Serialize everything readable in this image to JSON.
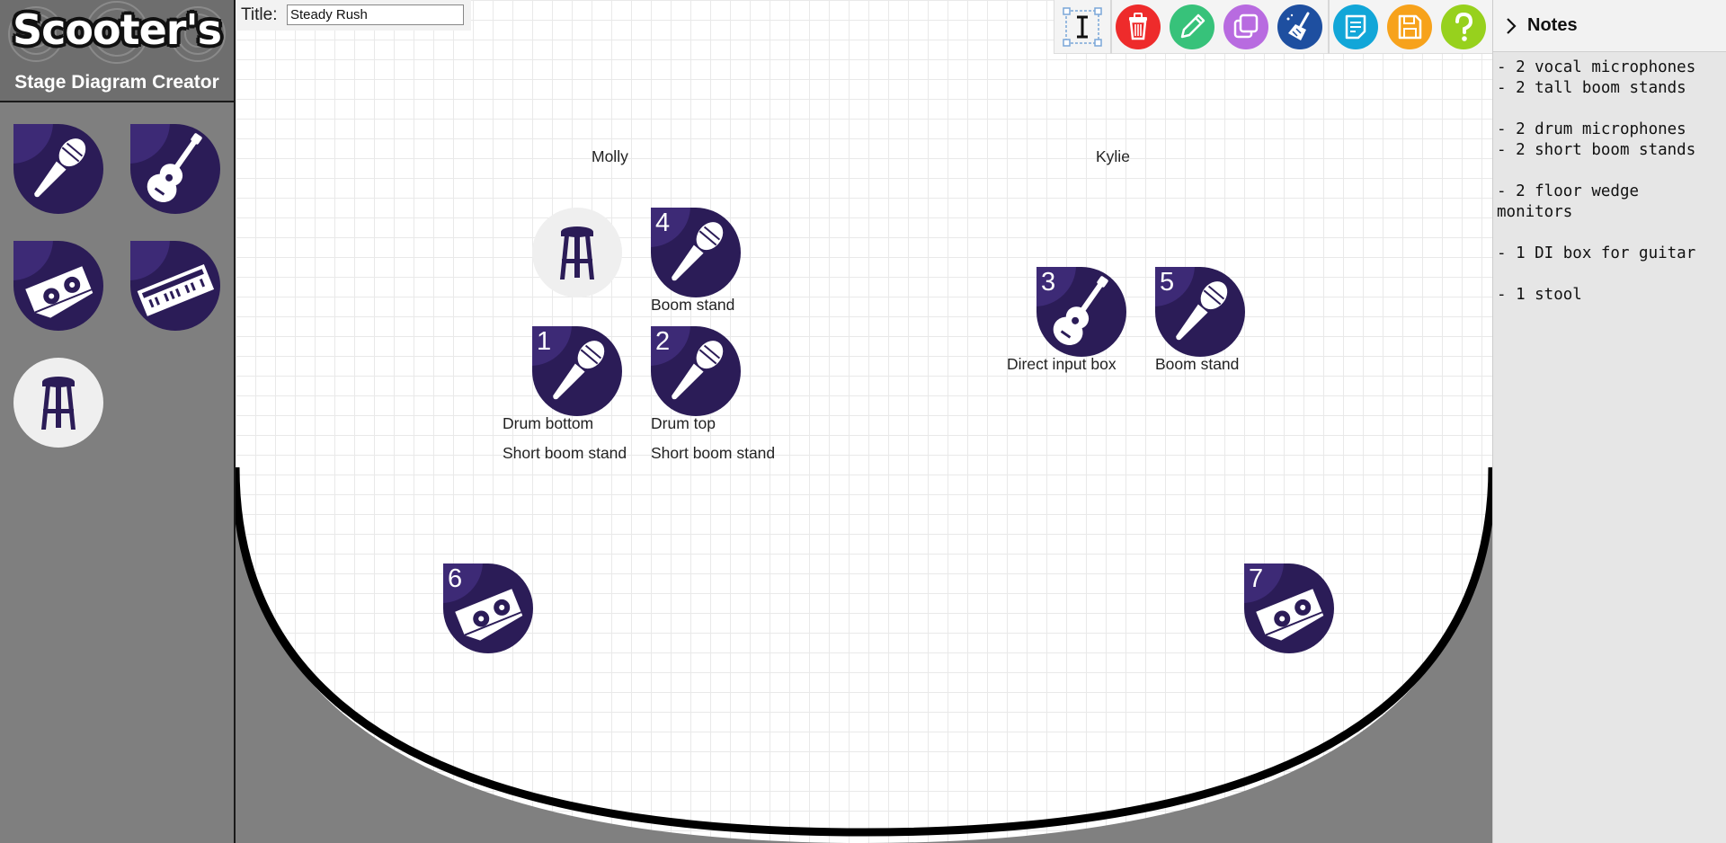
{
  "app": {
    "logo_text": "Scooter's",
    "title": "Stage Diagram Creator"
  },
  "palette": [
    {
      "name": "microphone",
      "icon": "microphone-icon"
    },
    {
      "name": "guitar",
      "icon": "guitar-icon"
    },
    {
      "name": "monitor-wedge",
      "icon": "monitor-wedge-icon"
    },
    {
      "name": "keyboard",
      "icon": "keyboard-icon"
    },
    {
      "name": "stool",
      "icon": "stool-icon"
    }
  ],
  "diagram": {
    "title_label": "Title:",
    "title_value": "Steady Rush",
    "performers": [
      "Molly",
      "Kylie"
    ],
    "items": [
      {
        "number": "",
        "icon": "stool-icon",
        "labels": []
      },
      {
        "number": "4",
        "icon": "microphone-icon",
        "labels": [
          "Boom stand"
        ]
      },
      {
        "number": "1",
        "icon": "microphone-icon",
        "labels": [
          "Drum bottom",
          "Short boom stand"
        ]
      },
      {
        "number": "2",
        "icon": "microphone-icon",
        "labels": [
          "Drum top",
          "Short boom stand"
        ]
      },
      {
        "number": "3",
        "icon": "guitar-icon",
        "labels": [
          "Direct input box"
        ]
      },
      {
        "number": "5",
        "icon": "microphone-icon",
        "labels": [
          "Boom stand"
        ]
      },
      {
        "number": "6",
        "icon": "monitor-wedge-icon",
        "labels": []
      },
      {
        "number": "7",
        "icon": "monitor-wedge-icon",
        "labels": []
      }
    ]
  },
  "toolbar": [
    {
      "name": "text-tool",
      "icon": "text-cursor-icon",
      "color": "#f4f4f4"
    },
    {
      "name": "delete",
      "icon": "trash-icon",
      "color": "#ee2b2b"
    },
    {
      "name": "edit",
      "icon": "pencil-icon",
      "color": "#37c27a"
    },
    {
      "name": "duplicate",
      "icon": "copy-icon",
      "color": "#b86be0"
    },
    {
      "name": "clear",
      "icon": "broom-icon",
      "color": "#1e4fa0"
    },
    {
      "name": "notes",
      "icon": "note-icon",
      "color": "#12a6d8"
    },
    {
      "name": "save",
      "icon": "save-icon",
      "color": "#f7a21b"
    },
    {
      "name": "help",
      "icon": "help-icon",
      "color": "#97d11d"
    }
  ],
  "notes": {
    "title": "Notes",
    "text": "- 2 vocal microphones\n- 2 tall boom stands\n\n- 2 drum microphones\n- 2 short boom stands\n\n- 2 floor wedge\nmonitors\n\n- 1 DI box for guitar\n\n- 1 stool"
  },
  "colors": {
    "item_fill": "#2b1c57",
    "item_highlight": "#3d2a76",
    "stool_fill": "#efefef",
    "stage_edge": "#000000",
    "offstage": "#808080"
  }
}
